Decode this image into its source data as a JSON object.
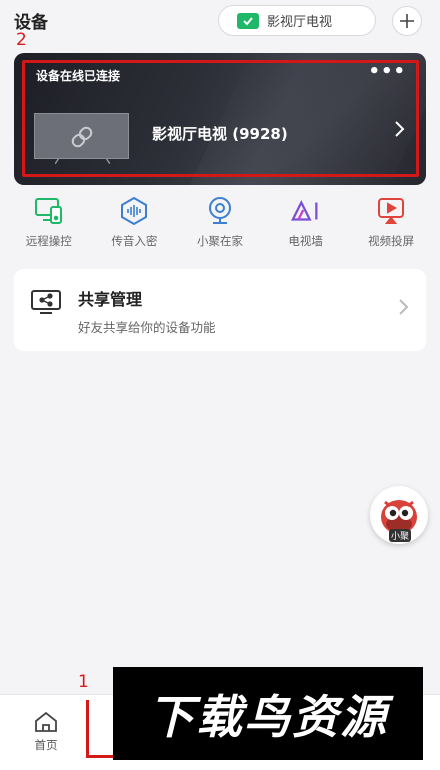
{
  "header": {
    "title": "设备",
    "current_device": "影视厅电视"
  },
  "annotations": {
    "label_1": "1",
    "label_2": "2"
  },
  "device_card": {
    "status": "设备在线已连接",
    "more": "•••",
    "device_name": "影视厅电视 (9928)"
  },
  "features": [
    {
      "label": "远程操控",
      "icon": "remote-control-icon",
      "color": "#1fb868"
    },
    {
      "label": "传音入密",
      "icon": "voice-wave-icon",
      "color": "#3a7fd0"
    },
    {
      "label": "小聚在家",
      "icon": "webcam-icon",
      "color": "#3a7fd0"
    },
    {
      "label": "电视墙",
      "icon": "ai-icon",
      "color": "#7a4fd6"
    },
    {
      "label": "视频投屏",
      "icon": "video-cast-icon",
      "color": "#e0443b"
    }
  ],
  "share": {
    "title": "共享管理",
    "subtitle": "好友共享给你的设备功能"
  },
  "assistant": {
    "label": "小聚"
  },
  "bottom_nav": {
    "home_label": "首页"
  },
  "watermark": {
    "text": "下载鸟资源"
  },
  "colors": {
    "accent_green": "#1fb868",
    "annotation_red": "#d41818"
  }
}
